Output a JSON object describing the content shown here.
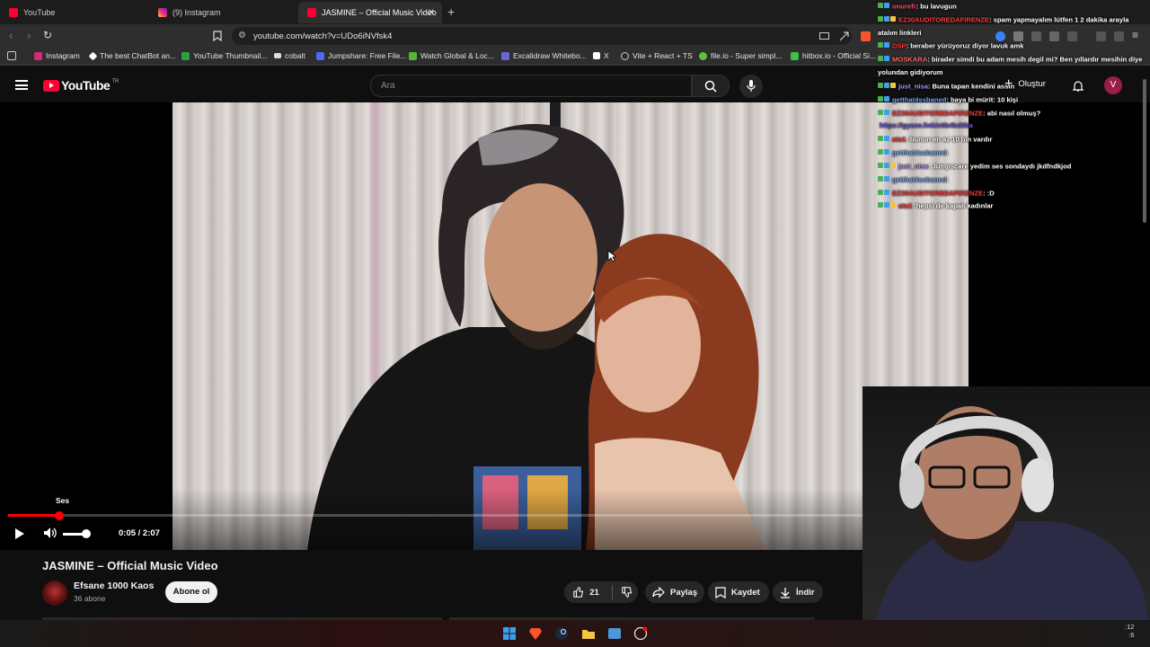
{
  "browser": {
    "tabs": [
      {
        "label": "YouTube",
        "color": "#ff0033"
      },
      {
        "label": "(9) Instagram",
        "color": "#d62976"
      },
      {
        "label": "JASMINE – Official Music Video",
        "color": "#ff0033",
        "active": true
      }
    ],
    "new_tab": "+",
    "close": "✕",
    "url": "youtube.com/watch?v=UDo6iNVfsk4",
    "bookmarks": [
      {
        "label": "Instagram",
        "color": "#d62976"
      },
      {
        "label": "The best ChatBot an...",
        "color": "#ffffff"
      },
      {
        "label": "YouTube Thumbnail...",
        "color": "#2ea043"
      },
      {
        "label": "cobalt",
        "color": "#dddddd"
      },
      {
        "label": "Jumpshare: Free File...",
        "color": "#4a6cf7"
      },
      {
        "label": "Watch Global & Loc...",
        "color": "#53b83a"
      },
      {
        "label": "Excalidraw Whitebo...",
        "color": "#6965db"
      },
      {
        "label": "X",
        "color": "#ffffff"
      },
      {
        "label": "Vite + React + TS",
        "color": "#cccccc"
      },
      {
        "label": "file.io - Super simpl...",
        "color": "#5fbf3f"
      },
      {
        "label": "hitbox.io - Official Si...",
        "color": "#3ac24a"
      }
    ]
  },
  "youtube": {
    "logo": "YouTube",
    "region": "TR",
    "search_placeholder": "Ara",
    "create_label": "Oluştur",
    "avatar_letter": "V",
    "tooltip": "Ses",
    "time": "0:05 / 2:07",
    "progress_fraction": 0.045,
    "volume_fraction": 0.85,
    "video_title": "JASMINE – Official Music Video",
    "channel_name": "Efsane 1000 Kaos",
    "subscribers": "36 abone",
    "subscribe_label": "Abone ol",
    "likes": "21",
    "share_label": "Paylaş",
    "save_label": "Kaydet",
    "download_label": "İndir"
  },
  "chat": [
    {
      "user": "onurefr",
      "color": "#ff4d6d",
      "msg": ": bu lavugun"
    },
    {
      "user": "EZ30AUDITOREDAFIRENZE",
      "color": "#ff3b3b",
      "msg": ": spam yapmayalım lütfen 1 2 dakika arayla atalım linkleri"
    },
    {
      "user": "DSP",
      "color": "#ff3b3b",
      "msg": ": beraber yürüyoruz diyor lavuk amk"
    },
    {
      "user": "MOSKARA",
      "color": "#ff6b6b",
      "msg": ": birader simdi bu adam mesih degil mi? Ben yıllardır mesihin diye yolundan gidiyorum"
    },
    {
      "user": "just_nisa",
      "color": "#b48cff",
      "msg": ": Buna tapan kendini assın"
    },
    {
      "user": "getthat4ssbaned",
      "color": "#6aa8ff",
      "msg": ": baya bi mürit: 10 kişi"
    },
    {
      "user": "EZ30AUDITOREDAFIRENZE",
      "color": "#ff3b3b",
      "msg": ": abi nasıl olmuş?"
    },
    {
      "user": "",
      "color": "#6a5acd",
      "msg": "https://gyazo.link/e0b4bd6ba"
    },
    {
      "user": "ata1",
      "color": "#ff3b3b",
      "msg": ": bunun en az 10 bin vardır"
    },
    {
      "user": "getthat4ssbaned",
      "color": "#6aa8ff",
      "msg": ":"
    },
    {
      "user": "just_nisa",
      "color": "#b48cff",
      "msg": ": Jumpscare yedim ses sondaydı jkdfndkjod"
    },
    {
      "user": "getthat4ssbaned",
      "color": "#6aa8ff",
      "msg": ":"
    },
    {
      "user": "EZ30AUDITOREDAFIRENZE",
      "color": "#ff3b3b",
      "msg": ": :D"
    },
    {
      "user": "ata1",
      "color": "#ff3b3b",
      "msg": ": hepsi de kapalı kadınlar"
    }
  ],
  "taskbar": {
    "clock_line1": ":12",
    "clock_line2": ":6"
  }
}
